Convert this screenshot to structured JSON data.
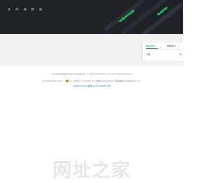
{
  "hero": {
    "tagline": "快 共 调 色 量"
  },
  "panel": {
    "tabs": [
      "最新发布",
      "收藏排行"
    ],
    "rows": [
      "标题:",
      "换:"
    ]
  },
  "footer": {
    "copyright": "北京某某网络科技有限公司 版权所有 © 2024 zhiwebsite.com All rights reserved.",
    "icp_left": "京ICP备19030420号",
    "police": "京公网安备 110105号(京公安备)",
    "icp_mid": "京ICP证050011号 京ICP备",
    "icp_right": "京ICP备19030441号-19",
    "link": "违法和不良信息举报 京ICP证050011号"
  },
  "watermark": "网址之家",
  "colors": {
    "hero_bg": "#1f2227",
    "accent_green": "#1fae5a",
    "link_blue": "#3b8fd6"
  }
}
